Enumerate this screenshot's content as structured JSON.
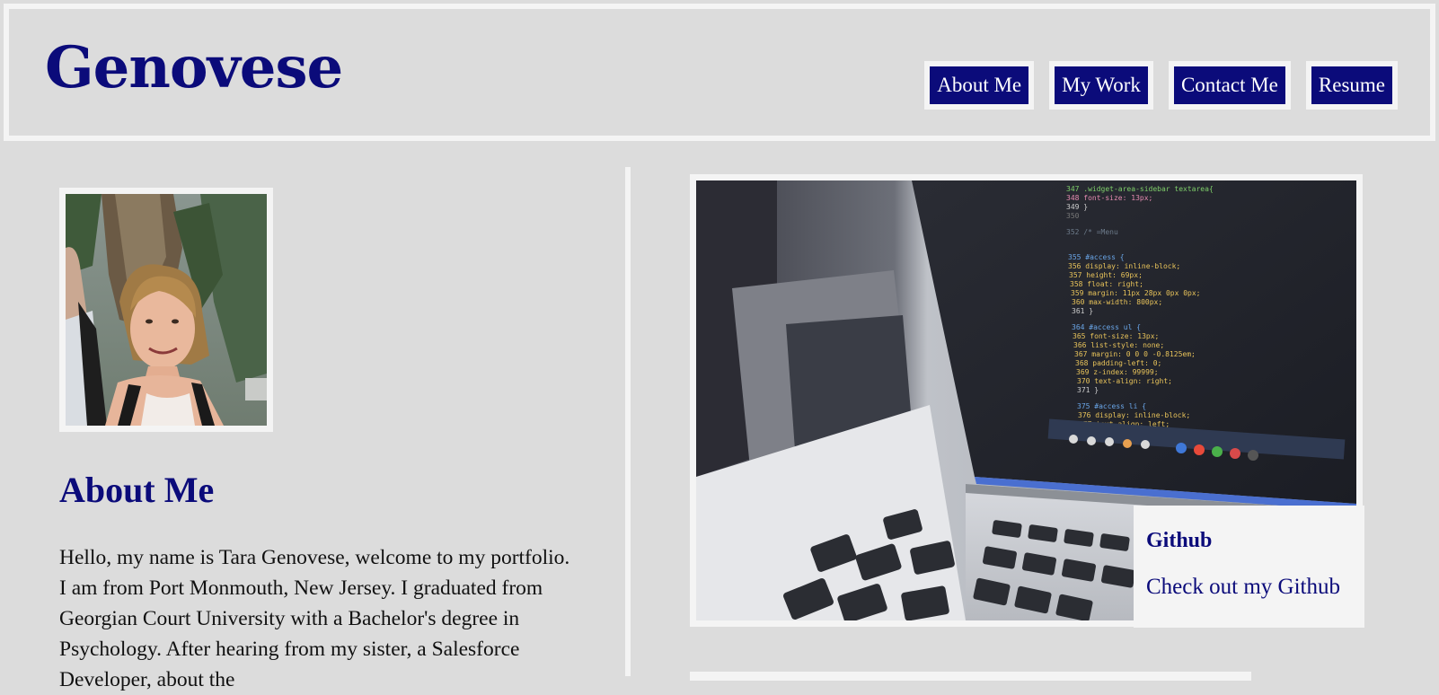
{
  "header": {
    "logo": "Genovese",
    "nav": [
      "About Me",
      "My Work",
      "Contact Me",
      "Resume"
    ]
  },
  "about": {
    "title": "About Me",
    "text": "Hello, my name is Tara Genovese, welcome to my portfolio. I am from Port Monmouth, New Jersey. I graduated from Georgian Court University with a Bachelor's degree in Psychology. After hearing from my sister, a Salesforce Developer, about the"
  },
  "project": {
    "title": "Github",
    "link": "Check out my Github",
    "screen_code": [
      "347 .widget-area-sidebar textarea{",
      "348   font-size: 13px;",
      "349 }",
      "350",
      "352 /* =Menu",
      "355 #access {",
      "356   display: inline-block;",
      "357   height: 69px;",
      "358   float: right;",
      "359   margin: 11px 28px 0px 0px;",
      "360   max-width: 800px;",
      "361 }",
      "364 #access ul {",
      "365   font-size: 13px;",
      "366   list-style: none;",
      "367   margin: 0 0 0 -0.8125em;",
      "368   padding-left: 0;",
      "369   z-index: 99999;",
      "370   text-align: right;",
      "371 }",
      "375 #access li {",
      "376   display: inline-block;",
      "377   text-align: left;"
    ]
  },
  "colors": {
    "accent": "#0b0b7a",
    "background": "#dcdcdc",
    "frame": "#f4f4f4"
  }
}
